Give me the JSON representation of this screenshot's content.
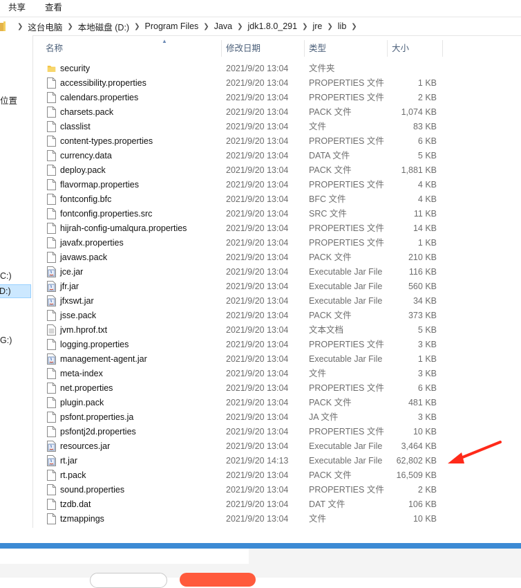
{
  "ribbon": {
    "share": "共享",
    "view": "查看"
  },
  "breadcrumb": [
    "这台电脑",
    "本地磁盘 (D:)",
    "Program Files",
    "Java",
    "jdk1.8.0_291",
    "jre",
    "lib"
  ],
  "nav": {
    "quick_access": "位置",
    "drive_c": "C:)",
    "drive_d": "D:)",
    "drive_g": "G:)"
  },
  "columns": {
    "name": "名称",
    "date": "修改日期",
    "type": "类型",
    "size": "大小"
  },
  "files": [
    {
      "name": "security",
      "date": "2021/9/20 13:04",
      "type": "文件夹",
      "size": "",
      "icon": "folder-icon"
    },
    {
      "name": "accessibility.properties",
      "date": "2021/9/20 13:04",
      "type": "PROPERTIES 文件",
      "size": "1 KB",
      "icon": "file-icon"
    },
    {
      "name": "calendars.properties",
      "date": "2021/9/20 13:04",
      "type": "PROPERTIES 文件",
      "size": "2 KB",
      "icon": "file-icon"
    },
    {
      "name": "charsets.pack",
      "date": "2021/9/20 13:04",
      "type": "PACK 文件",
      "size": "1,074 KB",
      "icon": "file-icon"
    },
    {
      "name": "classlist",
      "date": "2021/9/20 13:04",
      "type": "文件",
      "size": "83 KB",
      "icon": "file-icon"
    },
    {
      "name": "content-types.properties",
      "date": "2021/9/20 13:04",
      "type": "PROPERTIES 文件",
      "size": "6 KB",
      "icon": "file-icon"
    },
    {
      "name": "currency.data",
      "date": "2021/9/20 13:04",
      "type": "DATA 文件",
      "size": "5 KB",
      "icon": "file-icon"
    },
    {
      "name": "deploy.pack",
      "date": "2021/9/20 13:04",
      "type": "PACK 文件",
      "size": "1,881 KB",
      "icon": "file-icon"
    },
    {
      "name": "flavormap.properties",
      "date": "2021/9/20 13:04",
      "type": "PROPERTIES 文件",
      "size": "4 KB",
      "icon": "file-icon"
    },
    {
      "name": "fontconfig.bfc",
      "date": "2021/9/20 13:04",
      "type": "BFC 文件",
      "size": "4 KB",
      "icon": "file-icon"
    },
    {
      "name": "fontconfig.properties.src",
      "date": "2021/9/20 13:04",
      "type": "SRC 文件",
      "size": "11 KB",
      "icon": "file-icon"
    },
    {
      "name": "hijrah-config-umalqura.properties",
      "date": "2021/9/20 13:04",
      "type": "PROPERTIES 文件",
      "size": "14 KB",
      "icon": "file-icon"
    },
    {
      "name": "javafx.properties",
      "date": "2021/9/20 13:04",
      "type": "PROPERTIES 文件",
      "size": "1 KB",
      "icon": "file-icon"
    },
    {
      "name": "javaws.pack",
      "date": "2021/9/20 13:04",
      "type": "PACK 文件",
      "size": "210 KB",
      "icon": "file-icon"
    },
    {
      "name": "jce.jar",
      "date": "2021/9/20 13:04",
      "type": "Executable Jar File",
      "size": "116 KB",
      "icon": "jar-icon"
    },
    {
      "name": "jfr.jar",
      "date": "2021/9/20 13:04",
      "type": "Executable Jar File",
      "size": "560 KB",
      "icon": "jar-icon"
    },
    {
      "name": "jfxswt.jar",
      "date": "2021/9/20 13:04",
      "type": "Executable Jar File",
      "size": "34 KB",
      "icon": "jar-icon"
    },
    {
      "name": "jsse.pack",
      "date": "2021/9/20 13:04",
      "type": "PACK 文件",
      "size": "373 KB",
      "icon": "file-icon"
    },
    {
      "name": "jvm.hprof.txt",
      "date": "2021/9/20 13:04",
      "type": "文本文档",
      "size": "5 KB",
      "icon": "text-file-icon"
    },
    {
      "name": "logging.properties",
      "date": "2021/9/20 13:04",
      "type": "PROPERTIES 文件",
      "size": "3 KB",
      "icon": "file-icon"
    },
    {
      "name": "management-agent.jar",
      "date": "2021/9/20 13:04",
      "type": "Executable Jar File",
      "size": "1 KB",
      "icon": "jar-icon"
    },
    {
      "name": "meta-index",
      "date": "2021/9/20 13:04",
      "type": "文件",
      "size": "3 KB",
      "icon": "file-icon"
    },
    {
      "name": "net.properties",
      "date": "2021/9/20 13:04",
      "type": "PROPERTIES 文件",
      "size": "6 KB",
      "icon": "file-icon"
    },
    {
      "name": "plugin.pack",
      "date": "2021/9/20 13:04",
      "type": "PACK 文件",
      "size": "481 KB",
      "icon": "file-icon"
    },
    {
      "name": "psfont.properties.ja",
      "date": "2021/9/20 13:04",
      "type": "JA 文件",
      "size": "3 KB",
      "icon": "file-icon"
    },
    {
      "name": "psfontj2d.properties",
      "date": "2021/9/20 13:04",
      "type": "PROPERTIES 文件",
      "size": "10 KB",
      "icon": "file-icon"
    },
    {
      "name": "resources.jar",
      "date": "2021/9/20 13:04",
      "type": "Executable Jar File",
      "size": "3,464 KB",
      "icon": "jar-icon"
    },
    {
      "name": "rt.jar",
      "date": "2021/9/20 14:13",
      "type": "Executable Jar File",
      "size": "62,802 KB",
      "icon": "jar-icon"
    },
    {
      "name": "rt.pack",
      "date": "2021/9/20 13:04",
      "type": "PACK 文件",
      "size": "16,509 KB",
      "icon": "file-icon"
    },
    {
      "name": "sound.properties",
      "date": "2021/9/20 13:04",
      "type": "PROPERTIES 文件",
      "size": "2 KB",
      "icon": "file-icon"
    },
    {
      "name": "tzdb.dat",
      "date": "2021/9/20 13:04",
      "type": "DAT 文件",
      "size": "106 KB",
      "icon": "file-icon"
    },
    {
      "name": "tzmappings",
      "date": "2021/9/20 13:04",
      "type": "文件",
      "size": "10 KB",
      "icon": "file-icon"
    }
  ],
  "colors": {
    "annotation_arrow": "#ff2a1a",
    "selection": "#cce8ff",
    "accent_bar": "#3c8ad4",
    "header_text": "#4c607a"
  }
}
